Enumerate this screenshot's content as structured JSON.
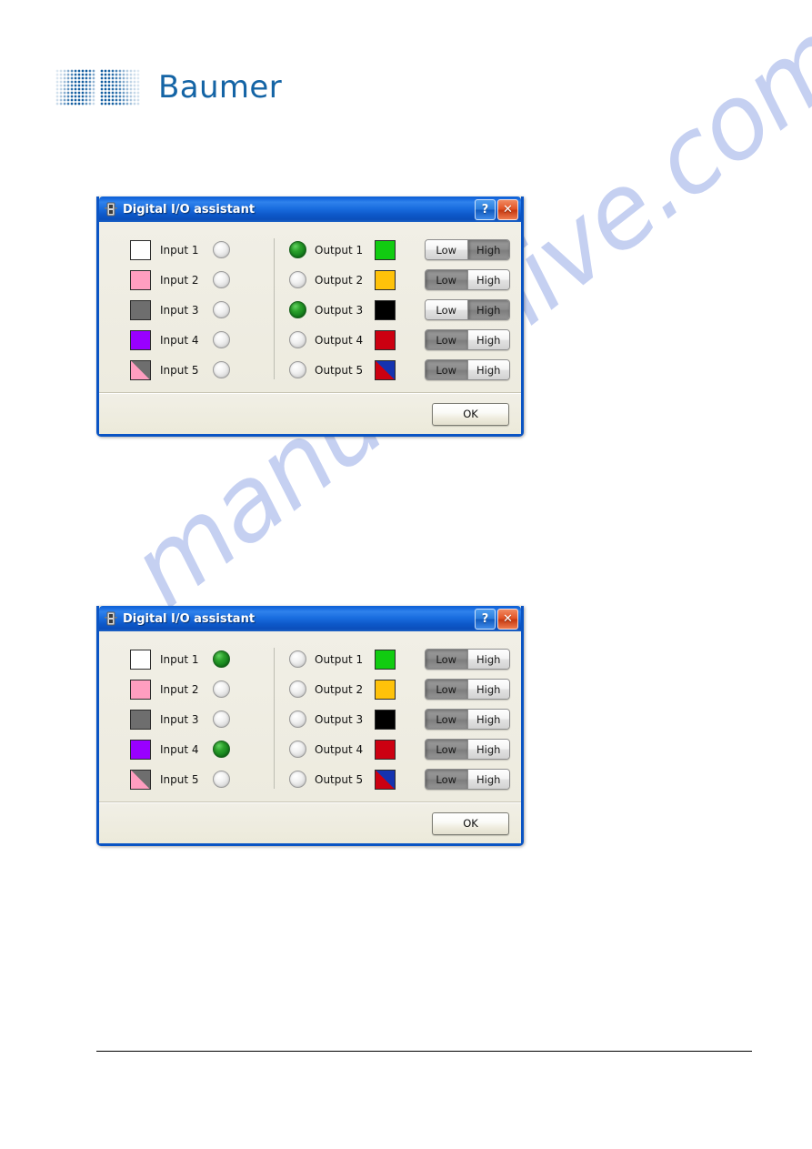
{
  "page": {
    "watermark_text": "manualshive.com",
    "brand": {
      "name": "Baumer",
      "logo_icon": "baumer-halftone-logo",
      "color": "#1464a5"
    }
  },
  "dialogs": [
    {
      "id": "dialog-1",
      "title": "Digital I/O assistant",
      "title_icon": "app-icon",
      "help_button": "?",
      "help_icon": "question-mark-icon",
      "close_button": "✕",
      "close_icon": "close-x-icon",
      "ok_label": "OK",
      "inputs": [
        {
          "label": "Input 1",
          "color": "#ffffff",
          "split": false,
          "led": "off"
        },
        {
          "label": "Input 2",
          "color": "#ff9ec0",
          "split": false,
          "led": "off"
        },
        {
          "label": "Input 3",
          "color": "#6e6e6e",
          "split": false,
          "led": "off"
        },
        {
          "label": "Input 4",
          "color": "#9900ff",
          "split": false,
          "led": "off"
        },
        {
          "label": "Input 5",
          "color": "#ff9ec0",
          "color2": "#6e6e6e",
          "split": true,
          "led": "off"
        }
      ],
      "outputs": [
        {
          "label": "Output 1",
          "color": "#11cc11",
          "split": false,
          "led": "on",
          "state": "High",
          "low_label": "Low",
          "high_label": "High"
        },
        {
          "label": "Output 2",
          "color": "#ffc20a",
          "split": false,
          "led": "off",
          "state": "Low",
          "low_label": "Low",
          "high_label": "High"
        },
        {
          "label": "Output 3",
          "color": "#000000",
          "split": false,
          "led": "on",
          "state": "High",
          "low_label": "Low",
          "high_label": "High"
        },
        {
          "label": "Output 4",
          "color": "#cc0011",
          "split": false,
          "led": "off",
          "state": "Low",
          "low_label": "Low",
          "high_label": "High"
        },
        {
          "label": "Output 5",
          "color": "#cc0011",
          "color2": "#1433b0",
          "split": true,
          "led": "off",
          "state": "Low",
          "low_label": "Low",
          "high_label": "High"
        }
      ]
    },
    {
      "id": "dialog-2",
      "title": "Digital I/O assistant",
      "title_icon": "app-icon",
      "help_button": "?",
      "help_icon": "question-mark-icon",
      "close_button": "✕",
      "close_icon": "close-x-icon",
      "ok_label": "OK",
      "inputs": [
        {
          "label": "Input 1",
          "color": "#ffffff",
          "split": false,
          "led": "on"
        },
        {
          "label": "Input 2",
          "color": "#ff9ec0",
          "split": false,
          "led": "off"
        },
        {
          "label": "Input 3",
          "color": "#6e6e6e",
          "split": false,
          "led": "off"
        },
        {
          "label": "Input 4",
          "color": "#9900ff",
          "split": false,
          "led": "on"
        },
        {
          "label": "Input 5",
          "color": "#ff9ec0",
          "color2": "#6e6e6e",
          "split": true,
          "led": "off"
        }
      ],
      "outputs": [
        {
          "label": "Output 1",
          "color": "#11cc11",
          "split": false,
          "led": "off",
          "state": "Low",
          "low_label": "Low",
          "high_label": "High"
        },
        {
          "label": "Output 2",
          "color": "#ffc20a",
          "split": false,
          "led": "off",
          "state": "Low",
          "low_label": "Low",
          "high_label": "High"
        },
        {
          "label": "Output 3",
          "color": "#000000",
          "split": false,
          "led": "off",
          "state": "Low",
          "low_label": "Low",
          "high_label": "High"
        },
        {
          "label": "Output 4",
          "color": "#cc0011",
          "split": false,
          "led": "off",
          "state": "Low",
          "low_label": "Low",
          "high_label": "High"
        },
        {
          "label": "Output 5",
          "color": "#cc0011",
          "color2": "#1433b0",
          "split": true,
          "led": "off",
          "state": "Low",
          "low_label": "Low",
          "high_label": "High"
        }
      ]
    }
  ]
}
